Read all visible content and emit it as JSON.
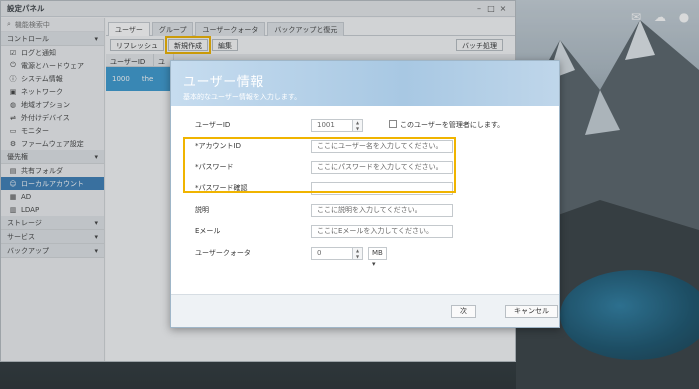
{
  "window": {
    "title": "設定パネル"
  },
  "sidebar": {
    "search_placeholder": "機能検索中",
    "items": [
      {
        "label": "コントロール",
        "type": "group"
      },
      {
        "label": "ログと通知",
        "type": "item",
        "icon": "log-icon"
      },
      {
        "label": "電源とハードウェア",
        "type": "item",
        "icon": "power-icon"
      },
      {
        "label": "システム情報",
        "type": "item",
        "icon": "info-icon"
      },
      {
        "label": "ネットワーク",
        "type": "item",
        "icon": "network-icon"
      },
      {
        "label": "地域オプション",
        "type": "item",
        "icon": "globe-icon"
      },
      {
        "label": "外付けデバイス",
        "type": "item",
        "icon": "usb-icon"
      },
      {
        "label": "モニター",
        "type": "item",
        "icon": "monitor-icon"
      },
      {
        "label": "ファームウェア設定",
        "type": "item",
        "icon": "firmware-icon"
      },
      {
        "label": "優先権",
        "type": "group"
      },
      {
        "label": "共有フォルダ",
        "type": "item",
        "icon": "folder-icon"
      },
      {
        "label": "ローカルアカウント",
        "type": "item",
        "icon": "user-icon",
        "active": true
      },
      {
        "label": "AD",
        "type": "item",
        "icon": "ad-icon"
      },
      {
        "label": "LDAP",
        "type": "item",
        "icon": "ldap-icon"
      },
      {
        "label": "ストレージ",
        "type": "group"
      },
      {
        "label": "サービス",
        "type": "group"
      },
      {
        "label": "バックアップ",
        "type": "group"
      }
    ]
  },
  "main": {
    "tabs": [
      "ユーザー",
      "グループ",
      "ユーザークォータ",
      "バックアップと復元"
    ],
    "toolbar": {
      "refresh": "リフレッシュ",
      "create": "新規作成",
      "edit": "編集",
      "batch": "バッチ処理"
    },
    "list_headers": [
      "ユーザーID",
      "ユ"
    ],
    "list_rows": [
      [
        "1000",
        "the"
      ]
    ]
  },
  "dialog": {
    "title": "ユーザー情報",
    "subtitle": "基本的なユーザー情報を入力します。",
    "user_id_label": "ユーザーID",
    "user_id_value": "1001",
    "admin_checkbox_label": "このユーザーを管理者にします。",
    "account_id_label": "*アカウントID",
    "account_id_placeholder": "ここにユーザー名を入力してください。",
    "password_label": "*パスワード",
    "password_placeholder": "ここにパスワードを入力してください。",
    "password_confirm_label": "*パスワード確認",
    "description_label": "説明",
    "description_placeholder": "ここに説明を入力してください。",
    "email_label": "Eメール",
    "email_placeholder": "ここにEメールを入力してください。",
    "quota_label": "ユーザークォータ",
    "quota_value": "0",
    "quota_unit": "MB",
    "next_button": "次",
    "cancel_button": "キャンセル"
  },
  "colors": {
    "accent": "#3d7fb8",
    "highlight": "#f0b400",
    "selected_row": "#3d9bd1"
  }
}
